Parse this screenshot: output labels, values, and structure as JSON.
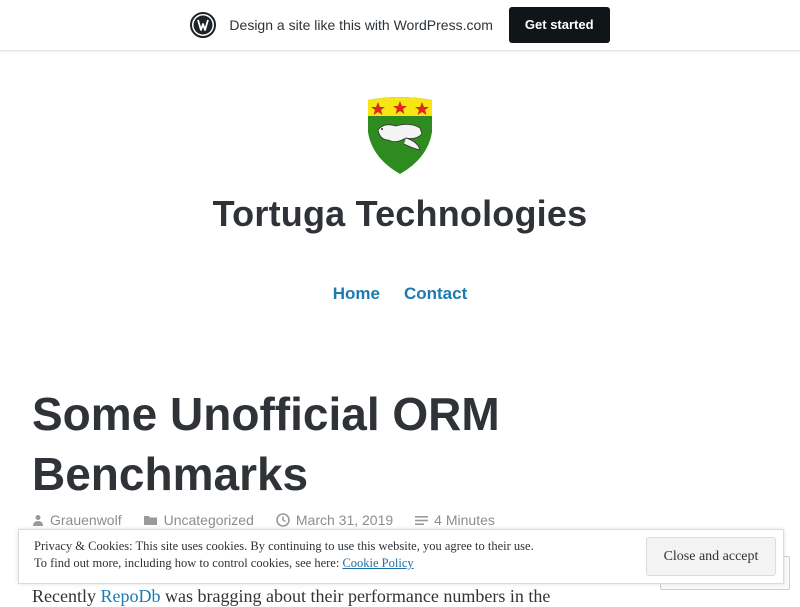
{
  "promo_bar": {
    "text": "Design a site like this with WordPress.com",
    "cta_label": "Get started"
  },
  "site": {
    "title": "Tortuga Technologies"
  },
  "nav": {
    "items": [
      {
        "label": "Home"
      },
      {
        "label": "Contact"
      }
    ]
  },
  "post": {
    "title": "Some Unofficial ORM Benchmarks",
    "author": "Grauenwolf",
    "category": "Uncategorized",
    "date": "March 31, 2019",
    "reading_time": "4 Minutes",
    "excerpt_before": "Recently ",
    "excerpt_link": "RepoDb",
    "excerpt_after": " was bragging about their performance numbers in the"
  },
  "cookie_banner": {
    "line1": "Privacy & Cookies: This site uses cookies. By continuing to use this website, you agree to their use.",
    "line2_prefix": "To find out more, including how to control cookies, see here: ",
    "policy_link": "Cookie Policy",
    "accept_label": "Close and accept"
  },
  "colors": {
    "link": "#1a7cb1",
    "title": "#2f3337",
    "cta_bg": "#101517",
    "logo_green": "#2e8b1f",
    "logo_yellow": "#f5e614",
    "logo_star": "#e0261d"
  },
  "icons": {
    "promo": "wordpress-logo-icon",
    "author": "person-icon",
    "category": "folder-icon",
    "date": "clock-icon",
    "reading_time": "lines-icon"
  }
}
